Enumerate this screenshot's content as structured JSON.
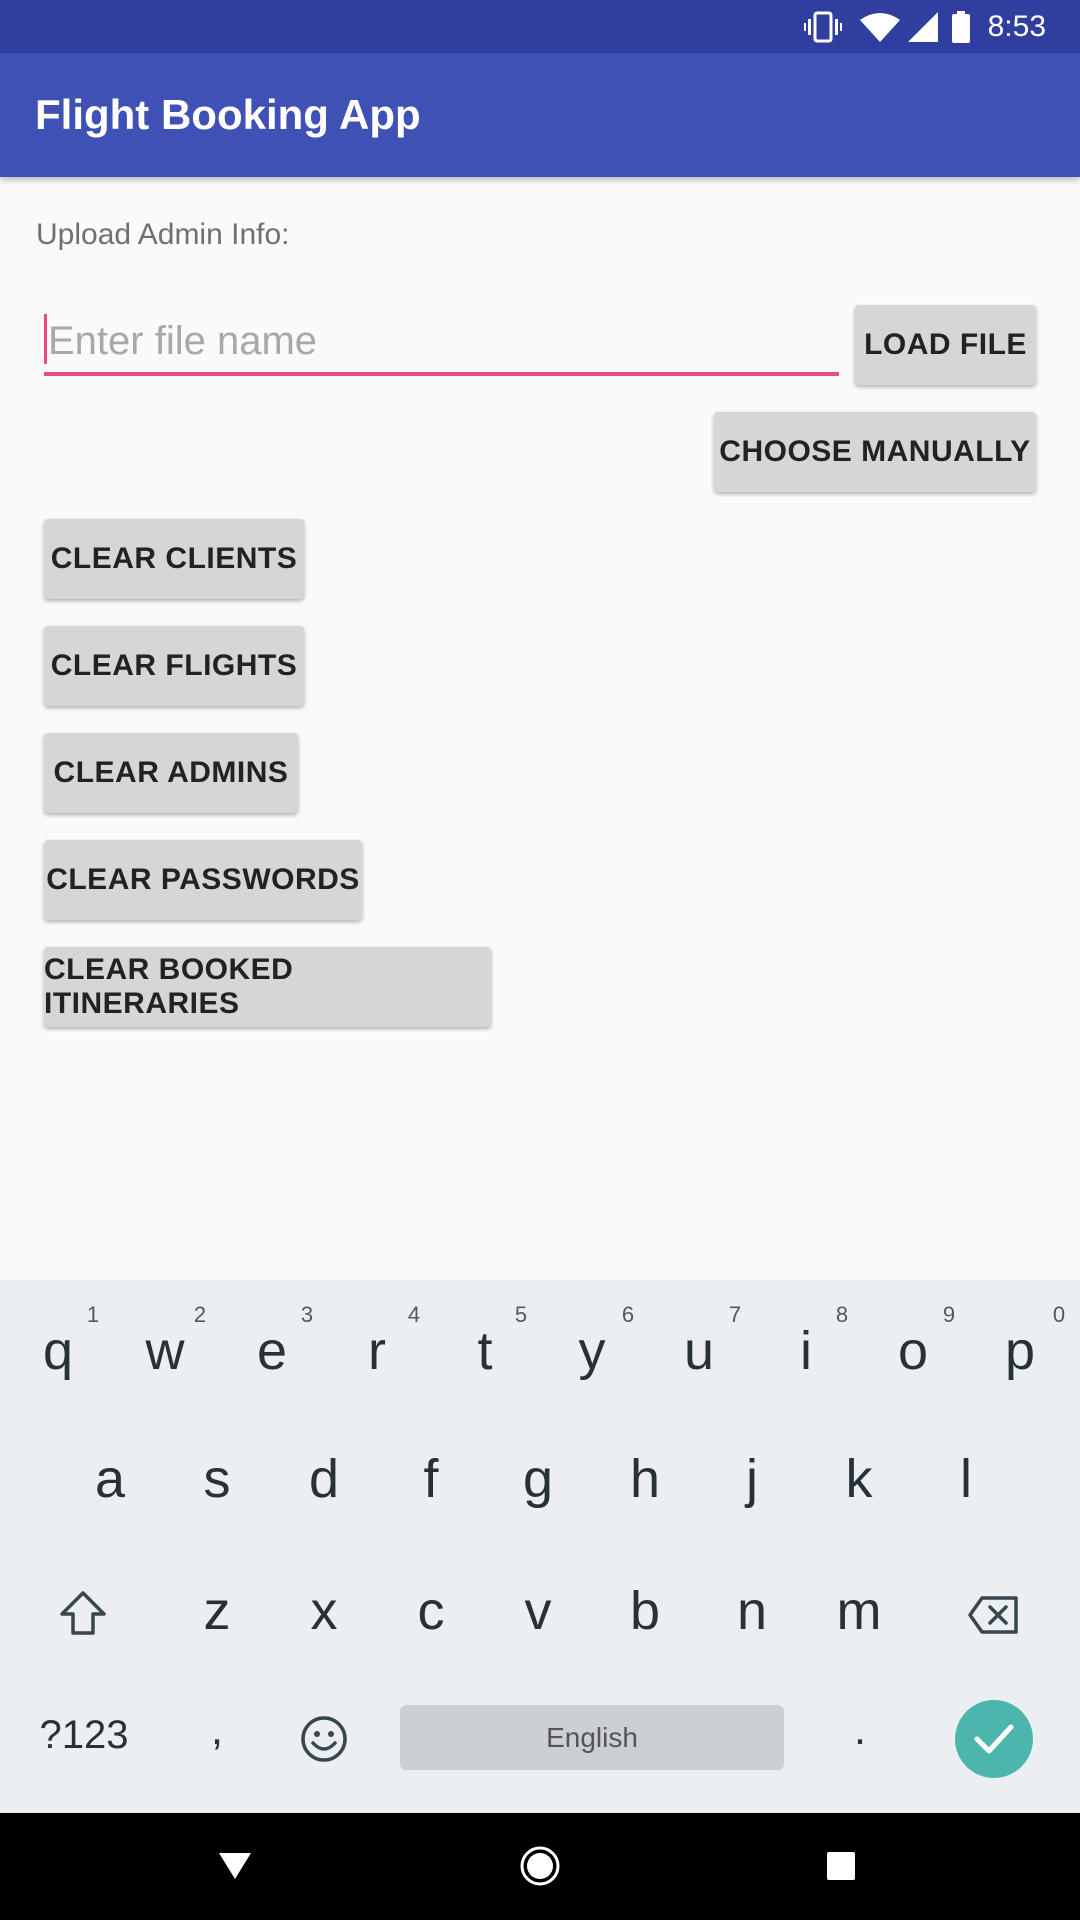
{
  "status_bar": {
    "time": "8:53",
    "icons": [
      "vibrate-icon",
      "wifi-icon",
      "signal-icon",
      "battery-icon"
    ]
  },
  "app_bar": {
    "title": "Flight Booking App"
  },
  "main": {
    "upload_label": "Upload Admin Info:",
    "file_input": {
      "placeholder": "Enter file name",
      "value": ""
    },
    "load_file_button": "LOAD FILE",
    "choose_manually_button": "CHOOSE MANUALLY",
    "clear_buttons": [
      "CLEAR CLIENTS",
      "CLEAR FLIGHTS",
      "CLEAR ADMINS",
      "CLEAR PASSWORDS",
      "CLEAR BOOKED ITINERARIES"
    ]
  },
  "keyboard": {
    "row1": [
      "q",
      "w",
      "e",
      "r",
      "t",
      "y",
      "u",
      "i",
      "o",
      "p"
    ],
    "row1_hints": [
      "1",
      "2",
      "3",
      "4",
      "5",
      "6",
      "7",
      "8",
      "9",
      "0"
    ],
    "row2": [
      "a",
      "s",
      "d",
      "f",
      "g",
      "h",
      "j",
      "k",
      "l"
    ],
    "row3": [
      "z",
      "x",
      "c",
      "v",
      "b",
      "n",
      "m"
    ],
    "symbols_key": "?123",
    "comma_key": ",",
    "period_key": ".",
    "spacebar_label": "English",
    "accent_color": "#4db6ac"
  },
  "colors": {
    "primary": "#3f51b5",
    "primary_dark": "#303f9f",
    "accent": "#e94c83"
  }
}
